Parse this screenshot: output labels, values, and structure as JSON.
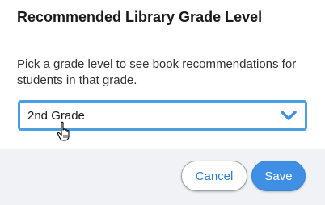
{
  "dialog": {
    "title": "Recommended Library Grade Level",
    "description": "Pick a grade level to see book recommendations for students in that grade.",
    "grade_select": {
      "selected": "2nd Grade",
      "icon": "chevron-down-icon"
    },
    "buttons": {
      "cancel_label": "Cancel",
      "save_label": "Save"
    }
  },
  "colors": {
    "accent": "#3f8fe4",
    "focus_border": "#4a9fe0",
    "footer_bg": "#f0f2f5"
  }
}
